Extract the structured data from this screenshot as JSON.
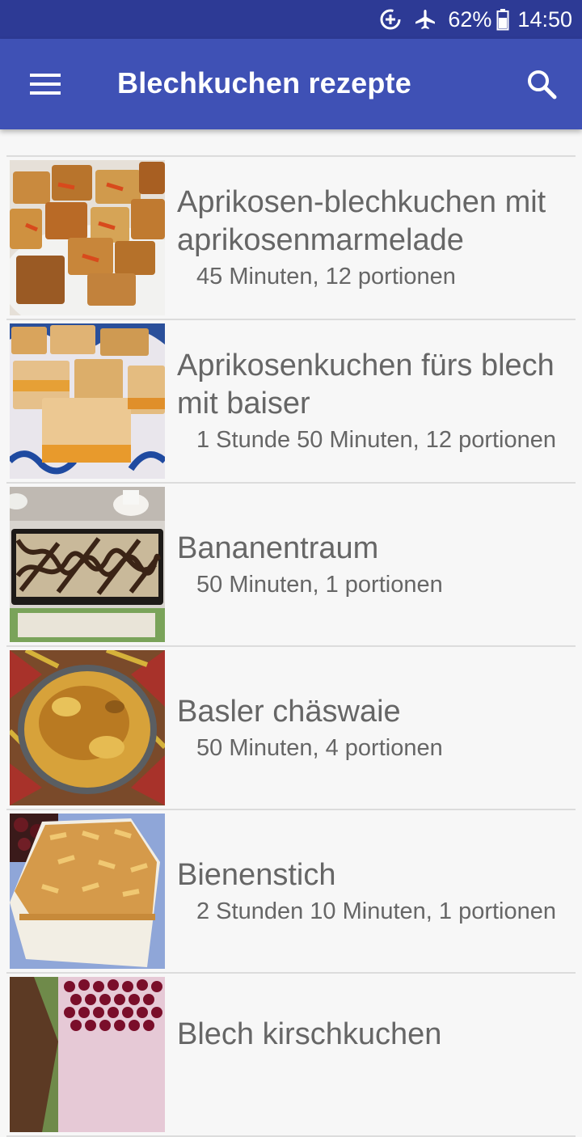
{
  "status_bar": {
    "battery_percent": "62%",
    "time": "14:50",
    "icons": [
      "data-saver-icon",
      "airplane-mode-icon",
      "battery-icon"
    ]
  },
  "app_bar": {
    "title": "Blechkuchen rezepte",
    "menu_icon": "hamburger-menu-icon",
    "search_icon": "search-icon"
  },
  "recipes": [
    {
      "title": "Aprikosen-blechkuchen mit aprikosenmarmelade",
      "meta": "45 Minuten, 12 portionen",
      "image": "apricot-crumble-squares"
    },
    {
      "title": "Aprikosenkuchen fürs blech mit baiser",
      "meta": "1 Stunde 50 Minuten, 12 portionen",
      "image": "apricot-meringue-squares"
    },
    {
      "title": "Bananentraum",
      "meta": "50 Minuten, 1 portionen",
      "image": "chocolate-drizzle-sheet-cake"
    },
    {
      "title": "Basler chäswaie",
      "meta": "50 Minuten, 4 portionen",
      "image": "cheese-tart-in-pan"
    },
    {
      "title": "Bienenstich",
      "meta": "2 Stunden 10 Minuten, 1 portionen",
      "image": "bee-sting-cake-slice"
    },
    {
      "title": "Blech kirschkuchen",
      "meta": "",
      "image": "cherry-sheet-cake"
    }
  ],
  "colors": {
    "status_bar": "#2d3a95",
    "app_bar": "#3f51b5",
    "background": "#f7f7f7",
    "text": "#666666",
    "divider": "#dcdcdc"
  }
}
